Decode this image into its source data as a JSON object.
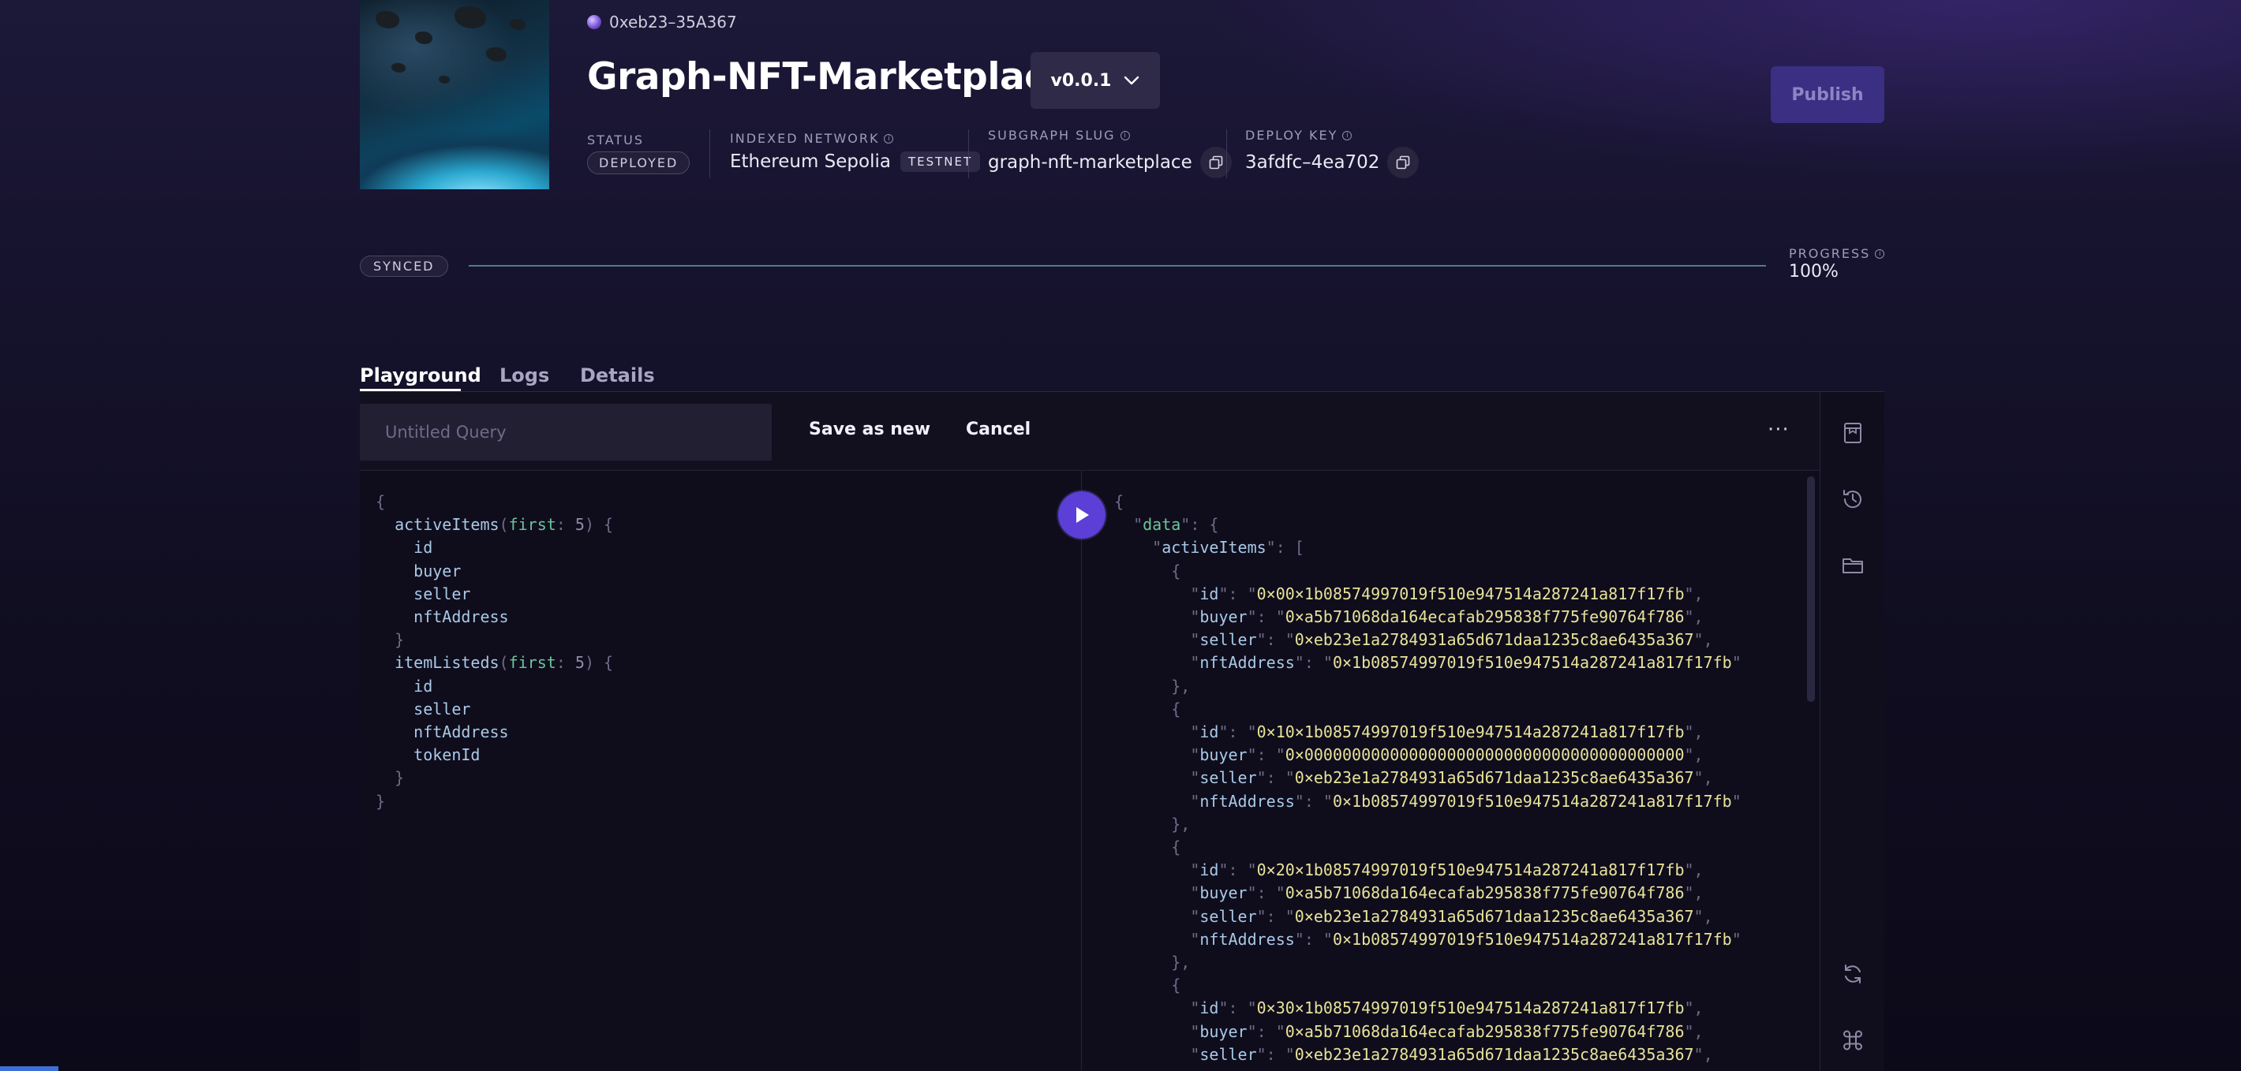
{
  "header": {
    "wallet_address": "0xeb23–35A367",
    "title": "Graph-NFT-Marketplace",
    "version": "v0.0.1",
    "publish_label": "Publish",
    "status": {
      "label": "STATUS",
      "value": "DEPLOYED"
    },
    "network": {
      "label": "INDEXED NETWORK",
      "value": "Ethereum Sepolia",
      "tag": "TESTNET"
    },
    "slug": {
      "label": "SUBGRAPH SLUG",
      "value": "graph-nft-marketplace"
    },
    "deploy_key": {
      "label": "DEPLOY KEY",
      "value": "3afdfc–4ea702"
    }
  },
  "sync": {
    "status": "SYNCED",
    "progress_label": "PROGRESS",
    "progress_value": "100%",
    "progress_fraction": 1.0
  },
  "tabs": [
    {
      "label": "Playground",
      "active": true
    },
    {
      "label": "Logs",
      "active": false
    },
    {
      "label": "Details",
      "active": false
    }
  ],
  "toolbar": {
    "query_name_placeholder": "Untitled Query",
    "save_as_new_label": "Save as new",
    "cancel_label": "Cancel",
    "more_label": "···"
  },
  "query": {
    "entities": [
      {
        "name": "activeItems",
        "arg": "first",
        "arg_value": "5",
        "fields": [
          "id",
          "buyer",
          "seller",
          "nftAddress"
        ]
      },
      {
        "name": "itemListeds",
        "arg": "first",
        "arg_value": "5",
        "fields": [
          "id",
          "seller",
          "nftAddress",
          "tokenId"
        ]
      }
    ]
  },
  "result": {
    "root_key": "data",
    "collection_key": "activeItems",
    "items": [
      {
        "id": "0×00×1b08574997019f510e947514a287241a817f17fb",
        "buyer": "0×a5b71068da164ecafab295838f775fe90764f786",
        "seller": "0×eb23e1a2784931a65d671daa1235c8ae6435a367",
        "nftAddress": "0×1b08574997019f510e947514a287241a817f17fb"
      },
      {
        "id": "0×10×1b08574997019f510e947514a287241a817f17fb",
        "buyer": "0×0000000000000000000000000000000000000000",
        "seller": "0×eb23e1a2784931a65d671daa1235c8ae6435a367",
        "nftAddress": "0×1b08574997019f510e947514a287241a817f17fb"
      },
      {
        "id": "0×20×1b08574997019f510e947514a287241a817f17fb",
        "buyer": "0×a5b71068da164ecafab295838f775fe90764f786",
        "seller": "0×eb23e1a2784931a65d671daa1235c8ae6435a367",
        "nftAddress": "0×1b08574997019f510e947514a287241a817f17fb"
      },
      {
        "id": "0×30×1b08574997019f510e947514a287241a817f17fb",
        "buyer": "0×a5b71068da164ecafab295838f775fe90764f786",
        "seller": "0×eb23e1a2784931a65d671daa1235c8ae6435a367"
      }
    ]
  },
  "rail_icons": [
    "bookmark-icon",
    "history-icon",
    "folder-icon",
    "refresh-icon",
    "command-key-icon"
  ]
}
